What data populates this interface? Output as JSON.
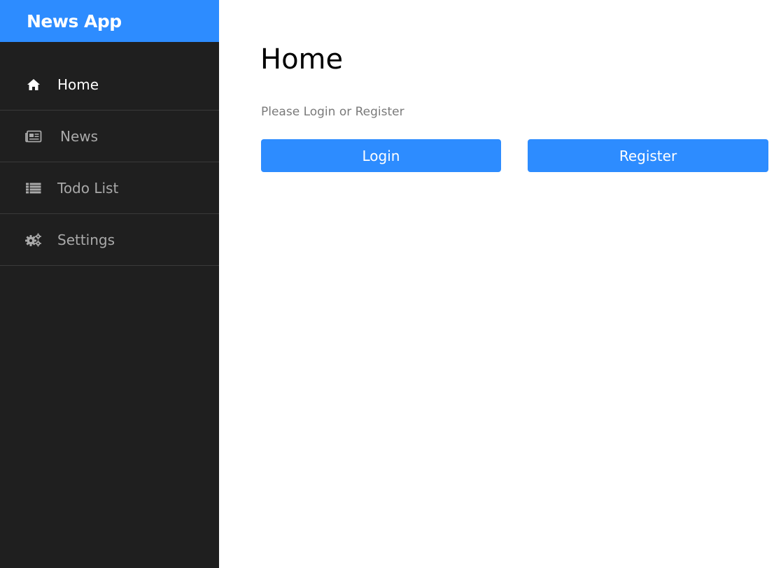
{
  "app": {
    "title": "News App",
    "brand_color": "#2d8cff",
    "sidebar_color": "#1f1f1f"
  },
  "sidebar": {
    "items": [
      {
        "label": "Home",
        "icon": "home-icon",
        "active": true
      },
      {
        "label": "News",
        "icon": "newspaper-icon",
        "active": false
      },
      {
        "label": "Todo List",
        "icon": "list-icon",
        "active": false
      },
      {
        "label": "Settings",
        "icon": "gears-icon",
        "active": false
      }
    ]
  },
  "main": {
    "title": "Home",
    "prompt": "Please Login or Register",
    "login_label": "Login",
    "register_label": "Register"
  }
}
